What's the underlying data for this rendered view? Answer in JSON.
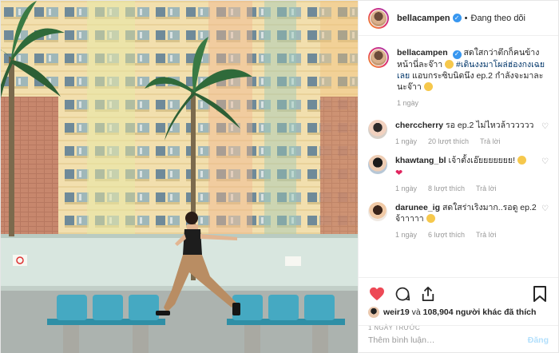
{
  "header": {
    "username": "bellacampen",
    "follow_label": "Đang theo dõi",
    "separator": "•"
  },
  "caption": {
    "username": "bellacampen",
    "text_before": "สดใสกว่าตึกก็คนข้างหน้านี่ละจ๊าา",
    "hashtag": "#เดินงงมาโผล่ฮ่องกงเฉยเลย",
    "text_after": "แอบกระซิบนิดนึง ep.2 กำลังจะมาละนะจ๊าา",
    "time": "1 ngày"
  },
  "comments": [
    {
      "username": "cherccherry",
      "text": "รอ ep.2 ไม่ไหวล้าววววว",
      "time": "1 ngày",
      "likes": "20 lượt thích",
      "reply": "Trả lời"
    },
    {
      "username": "khawtang_bl",
      "text": "เจ้าตั้งเอ๊ยยยยยยย!",
      "time": "1 ngày",
      "likes": "8 lượt thích",
      "reply": "Trả lời"
    },
    {
      "username": "darunee_ig",
      "text": "สดใสร่าเริงมาก..รอดู ep.2 จ้าาาาา",
      "time": "1 ngày",
      "likes": "6 lượt thích",
      "reply": "Trả lời"
    }
  ],
  "likes": {
    "user": "weir19",
    "connector": "và",
    "count": "108,904",
    "rest": "người khác đã thích"
  },
  "time_ago": "1 NGÀY TRƯỚC",
  "comment_input": {
    "placeholder": "Thêm bình luận…",
    "post_label": "Đăng"
  },
  "icons": {
    "like": "heart-filled-icon",
    "comment": "comment-icon",
    "share": "share-icon",
    "save": "bookmark-icon",
    "verified": "verified-badge-icon"
  },
  "colors": {
    "like_red": "#ed4956",
    "link": "#003569",
    "verified": "#3897f0",
    "post_disabled": "#b2dffc"
  }
}
